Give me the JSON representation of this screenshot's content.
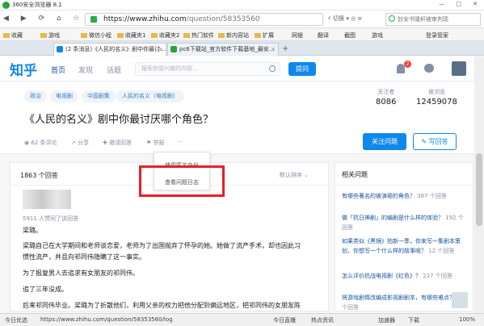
{
  "browser": {
    "title": "360安全浏览器 8.1",
    "window_controls": "— □ ✕",
    "nav_icons": "◀ ▶ ⟳ ⌂ ☆",
    "url_host": "https://www.zhihu.com",
    "url_path": "/question/58353560",
    "address_tools": "⚡ 切换 ▾  ◎ ≡",
    "search_placeholder": "封安书骚轩被审判现",
    "bookmarks": [
      "收藏",
      "游戏",
      "微信小程",
      "收藏夹1",
      "收藏夹2",
      "热门软件",
      "新内容站",
      "扩展",
      "网银",
      "翻译",
      "截图",
      "游戏",
      "登录管家"
    ],
    "tabs": [
      {
        "label": "(2 条消息)《人民的名义》剧中你最讨...",
        "close": "×"
      },
      {
        "label": "pc6下载站_官方软件下载基地_最安...",
        "close": "×"
      }
    ],
    "new_tab": "+"
  },
  "zhihu": {
    "logo": "知乎",
    "nav": [
      "首页",
      "发现",
      "话题"
    ],
    "search_placeholder": "搜索你感兴趣的内容...",
    "ask_button": "提问",
    "notification_count": "2"
  },
  "question": {
    "tags": [
      "政治",
      "电视剧",
      "中国剧集",
      "人民的名义（电视剧）"
    ],
    "title": "《人民的名义》剧中你最讨厌哪个角色？",
    "actions": [
      "62 条评论",
      "分享",
      "邀请回答",
      "举报",
      "···"
    ],
    "followers_label": "关注者",
    "followers": "8086",
    "views_label": "被浏览",
    "views": "12459078",
    "follow_button": "关注问题",
    "write_button": "写回答"
  },
  "dropdown": {
    "items": [
      "使用匿名身份",
      "查看问题日志"
    ]
  },
  "answers": {
    "count": "1863 个回答",
    "sort": "默认排序 ⌄",
    "agree": "5911 人赞同了该回答",
    "paragraphs": [
      "梁璐。",
      "梁璐自己在大学期间和老师谈恋爱，老师为了出国抛弃了怀孕的她。她做了流产手术，却也因此习",
      "惯性流产，并且向祁同伟隐瞒了这一事实。",
      "为了报复男人去追求有女朋友的祁同伟。",
      "追了三年没成。",
      "后来祁同伟毕业。梁璐为了折散他们，利用父亲的权力把他分配到偏远地区，把祁同伟的女朋友陈"
    ]
  },
  "sidebar": {
    "heading": "相关问题",
    "items": [
      {
        "q": "有哪些著名的被演砸的角色？",
        "n": "367 个回答"
      },
      {
        "q": "做「抗日神剧」的编剧是什么样的体验？",
        "n": "192 个回答"
      },
      {
        "q": "如果类似《黑镜》拍新一季，你来写一集剧本策划，你想写一个什么样的故事呢？",
        "n": "12 个回答"
      },
      {
        "q": "怎么评价抗战电视剧《红色》？",
        "n": "227 个回答"
      },
      {
        "q": "将游戏剧情改编成影视剧剧本，有哪些难点？",
        "n": "10 个回答"
      }
    ]
  },
  "status": {
    "left": "今日优选",
    "url": "https://www.zhihu.com/question/58353560/log",
    "items": [
      "今日直播",
      "热点资讯",
      "加速器",
      "下载",
      "100%"
    ]
  },
  "colors": {
    "brand": "#0f88eb",
    "highlight_box": "#e8202a"
  }
}
